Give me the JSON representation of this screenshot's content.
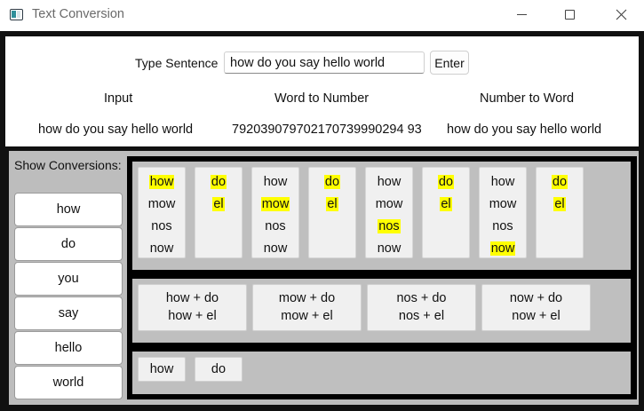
{
  "window": {
    "title": "Text Conversion"
  },
  "form": {
    "type_label": "Type Sentence",
    "sentence_value": "how do you say hello world",
    "enter_label": "Enter"
  },
  "headers": {
    "input": "Input",
    "word_to_number": "Word to Number",
    "number_to_word": "Number to Word"
  },
  "values": {
    "input": "how do you say hello world",
    "word_to_number": "792039079702170739990294 93",
    "number_to_word": "how do you say hello world"
  },
  "sidebar": {
    "label": "Show Conversions:",
    "words": [
      "how",
      "do",
      "you",
      "say",
      "hello",
      "world"
    ]
  },
  "cards": [
    {
      "words": [
        "how",
        "mow",
        "nos",
        "now"
      ],
      "highlight": 0
    },
    {
      "words": [
        "do",
        "el"
      ],
      "highlight": 0
    },
    {
      "words": [
        "how",
        "mow",
        "nos",
        "now"
      ],
      "highlight": 1
    },
    {
      "words": [
        "do",
        "el"
      ],
      "highlight": 0
    },
    {
      "words": [
        "how",
        "mow",
        "nos",
        "now"
      ],
      "highlight": 2
    },
    {
      "words": [
        "do",
        "el"
      ],
      "highlight": 0
    },
    {
      "words": [
        "how",
        "mow",
        "nos",
        "now"
      ],
      "highlight": 3
    },
    {
      "words": [
        "do",
        "el"
      ],
      "highlight": 0
    }
  ],
  "combinations": [
    [
      "how + do",
      "how + el"
    ],
    [
      "mow + do",
      "mow + el"
    ],
    [
      "nos + do",
      "nos + el"
    ],
    [
      "now + do",
      "now + el"
    ]
  ],
  "selected_words": [
    "how",
    "do"
  ],
  "colors": {
    "highlight": "#ffff00",
    "frame": "#111111",
    "panel_gray": "#bfbfbf"
  }
}
